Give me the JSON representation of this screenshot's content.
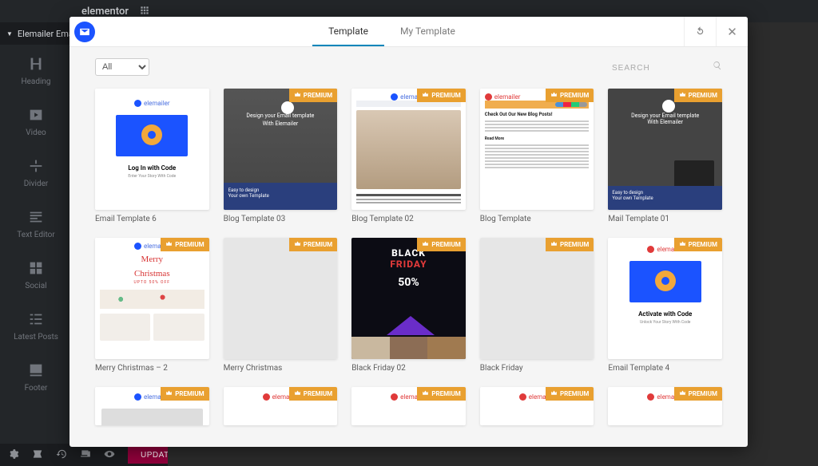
{
  "appbar": {
    "brand": "elementor"
  },
  "sidebar": {
    "section_title": "Elemailer Email",
    "widgets": [
      {
        "label": "Heading",
        "icon": "heading"
      },
      {
        "label": "Video",
        "icon": "video"
      },
      {
        "label": "Divider",
        "icon": "divider"
      },
      {
        "label": "Text Editor",
        "icon": "text"
      },
      {
        "label": "Social",
        "icon": "social"
      },
      {
        "label": "Latest Posts",
        "icon": "list"
      },
      {
        "label": "Footer",
        "icon": "footer"
      }
    ]
  },
  "bottombar": {
    "update_label": "UPDATE"
  },
  "modal": {
    "tabs": {
      "template": "Template",
      "my_template": "My Template"
    },
    "filter": {
      "value": "All"
    },
    "search": {
      "placeholder": "SEARCH"
    },
    "badge_label": "PREMIUM",
    "cards": [
      {
        "title": "Email Template 6",
        "premium": false,
        "thumb": "email6"
      },
      {
        "title": "Blog Template 03",
        "premium": true,
        "thumb": "blog03"
      },
      {
        "title": "Blog Template 02",
        "premium": true,
        "thumb": "blog02"
      },
      {
        "title": "Blog Template",
        "premium": true,
        "thumb": "blog"
      },
      {
        "title": "Mail Template 01",
        "premium": true,
        "thumb": "mail01"
      },
      {
        "title": "Merry Christmas – 2",
        "premium": true,
        "thumb": "xmas2"
      },
      {
        "title": "Merry Christmas",
        "premium": true,
        "thumb": "blank"
      },
      {
        "title": "Black Friday 02",
        "premium": true,
        "thumb": "bf02"
      },
      {
        "title": "Black Friday",
        "premium": true,
        "thumb": "blank"
      },
      {
        "title": "Email Template 4",
        "premium": true,
        "thumb": "activate"
      },
      {
        "title": "",
        "premium": true,
        "thumb": "stub_blue"
      },
      {
        "title": "",
        "premium": true,
        "thumb": "stub_red"
      },
      {
        "title": "",
        "premium": true,
        "thumb": "stub_red"
      },
      {
        "title": "",
        "premium": true,
        "thumb": "stub_red"
      },
      {
        "title": "",
        "premium": true,
        "thumb": "stub_red"
      }
    ],
    "thumb_text": {
      "email6": {
        "logo": "elemailer",
        "cap": "Log In with Code",
        "sub": "Enter Your Story With Code"
      },
      "blog03": {
        "line1": "Design your Email template",
        "line2": "With Elemailer",
        "foot1": "Easy to design",
        "foot2": "Your own Template"
      },
      "mail01": {
        "line1": "Design your Email template",
        "line2": "With Elemailer",
        "foot1": "Easy to design",
        "foot2": "Your own Template"
      },
      "blog02": {
        "logo": "elemailer",
        "h": "Maecenas volutpat mus mauris ultrices lacinia",
        "s": "Nullam velit ut tortor pretium"
      },
      "blog": {
        "logo": "elemailer",
        "h": "Check Out Our New Blog Posts!"
      },
      "xmas": {
        "logo": "elemailer",
        "script1": "Merry",
        "script2": "Christmas",
        "off": "UPTO 50% OFF"
      },
      "bf": {
        "w1": "BLACK",
        "w2": "FRIDAY",
        "pct": "50%"
      },
      "activate": {
        "logo": "elemailer",
        "cap": "Activate with Code",
        "sub": "Unlock Your Story With Code"
      }
    }
  }
}
